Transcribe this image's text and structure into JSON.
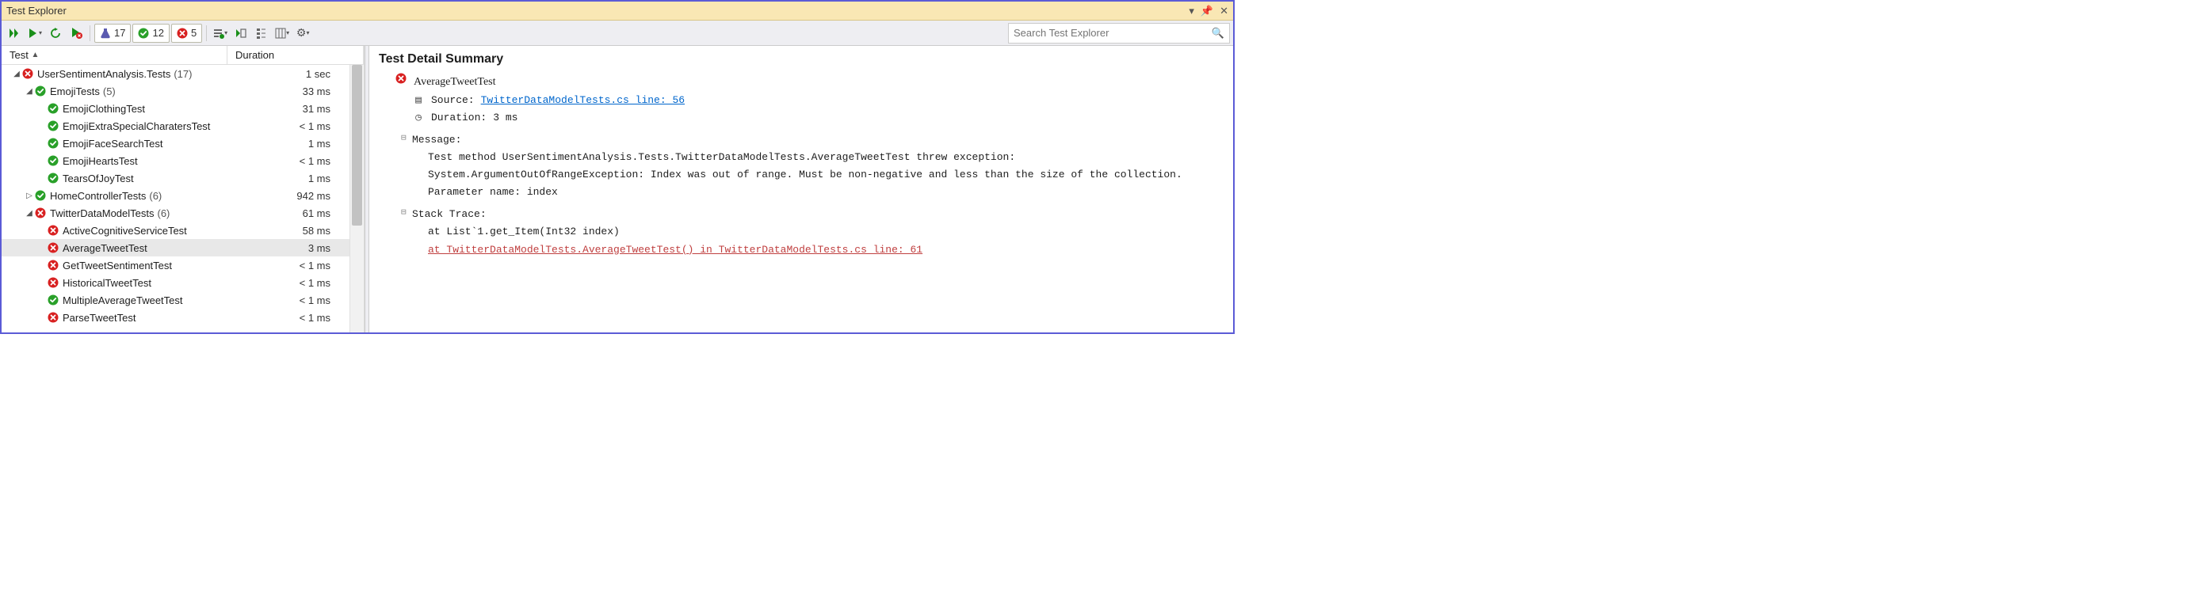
{
  "window": {
    "title": "Test Explorer"
  },
  "toolbar": {
    "flask_count": 17,
    "pass_count": 12,
    "fail_count": 5
  },
  "search": {
    "placeholder": "Search Test Explorer"
  },
  "columns": {
    "test": "Test",
    "duration": "Duration"
  },
  "tree": {
    "root": {
      "label": "UserSentimentAnalysis.Tests",
      "count": "(17)",
      "duration": "1 sec",
      "status": "fail"
    },
    "group1": {
      "label": "EmojiTests",
      "count": "(5)",
      "duration": "33 ms",
      "status": "pass",
      "items": [
        {
          "label": "EmojiClothingTest",
          "duration": "31 ms",
          "status": "pass"
        },
        {
          "label": "EmojiExtraSpecialCharatersTest",
          "duration": "< 1 ms",
          "status": "pass"
        },
        {
          "label": "EmojiFaceSearchTest",
          "duration": "1 ms",
          "status": "pass"
        },
        {
          "label": "EmojiHeartsTest",
          "duration": "< 1 ms",
          "status": "pass"
        },
        {
          "label": "TearsOfJoyTest",
          "duration": "1 ms",
          "status": "pass"
        }
      ]
    },
    "group2": {
      "label": "HomeControllerTests",
      "count": "(6)",
      "duration": "942 ms",
      "status": "pass"
    },
    "group3": {
      "label": "TwitterDataModelTests",
      "count": "(6)",
      "duration": "61 ms",
      "status": "fail",
      "items": [
        {
          "label": "ActiveCognitiveServiceTest",
          "duration": "58 ms",
          "status": "fail"
        },
        {
          "label": "AverageTweetTest",
          "duration": "3 ms",
          "status": "fail",
          "selected": true
        },
        {
          "label": "GetTweetSentimentTest",
          "duration": "< 1 ms",
          "status": "fail"
        },
        {
          "label": "HistoricalTweetTest",
          "duration": "< 1 ms",
          "status": "fail"
        },
        {
          "label": "MultipleAverageTweetTest",
          "duration": "< 1 ms",
          "status": "pass"
        },
        {
          "label": "ParseTweetTest",
          "duration": "< 1 ms",
          "status": "fail"
        }
      ]
    }
  },
  "detail": {
    "heading": "Test Detail Summary",
    "test_name": "AverageTweetTest",
    "source_label": "Source:",
    "source_link": "TwitterDataModelTests.cs line: 56",
    "duration_label": "Duration:",
    "duration_value": "3 ms",
    "message_label": "Message:",
    "message_line1": "Test method UserSentimentAnalysis.Tests.TwitterDataModelTests.AverageTweetTest threw exception:",
    "message_line2": "System.ArgumentOutOfRangeException: Index was out of range. Must be non-negative and less than the size of the collection.",
    "message_line3": "Parameter name: index",
    "stack_label": "Stack Trace:",
    "stack_line1": "at List`1.get_Item(Int32 index)",
    "stack_link": "at TwitterDataModelTests.AverageTweetTest() in TwitterDataModelTests.cs line: 61"
  }
}
